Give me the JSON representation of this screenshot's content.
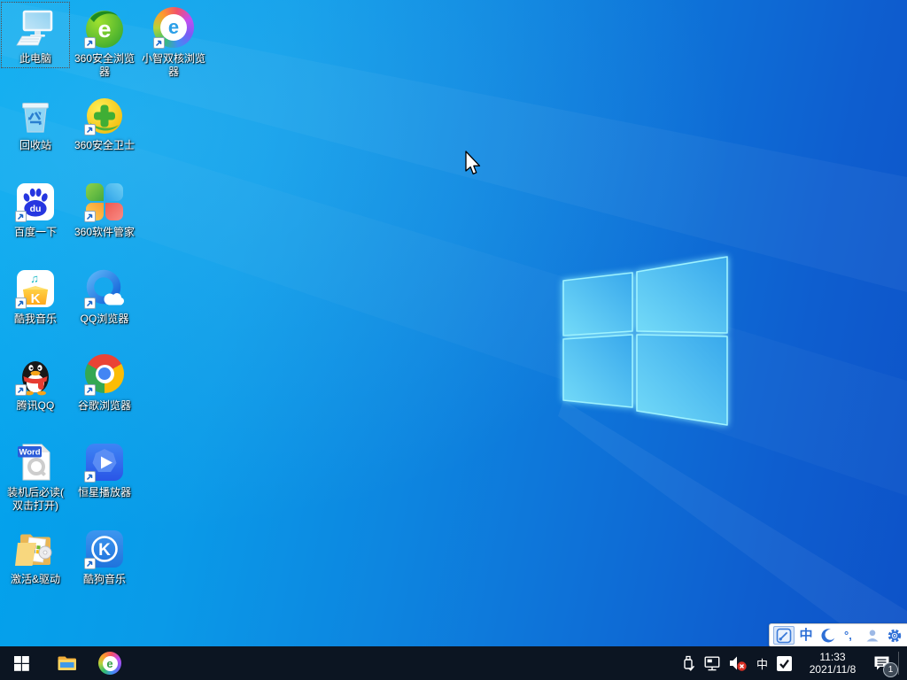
{
  "wallpaper": {
    "name": "windows-10-light-ray",
    "base_left_color": "#00a6ee",
    "base_right_color": "#0d52c8",
    "logo_edge_color": "#9ef2fe"
  },
  "desktop_icons": [
    {
      "id": "this-pc",
      "label": "此电脑",
      "selected": true,
      "shortcut": false
    },
    {
      "id": "360-secure-browser",
      "label": "360安全浏览\n器",
      "selected": false,
      "shortcut": true
    },
    {
      "id": "xiaozhi-dual-core-browser",
      "label": "小智双核浏览\n器",
      "selected": false,
      "shortcut": true
    },
    {
      "id": "recycle-bin",
      "label": "回收站",
      "selected": false,
      "shortcut": false
    },
    {
      "id": "360-safe-guard",
      "label": "360安全卫士",
      "selected": false,
      "shortcut": true
    },
    {
      "id": "baidu-search",
      "label": "百度一下",
      "selected": false,
      "shortcut": true
    },
    {
      "id": "360-software-manager",
      "label": "360软件管家",
      "selected": false,
      "shortcut": true
    },
    {
      "id": "kuwo-music",
      "label": "酷我音乐",
      "selected": false,
      "shortcut": true
    },
    {
      "id": "qq-browser",
      "label": "QQ浏览器",
      "selected": false,
      "shortcut": true
    },
    {
      "id": "tencent-qq",
      "label": "腾讯QQ",
      "selected": false,
      "shortcut": true
    },
    {
      "id": "google-chrome",
      "label": "谷歌浏览器",
      "selected": false,
      "shortcut": true
    },
    {
      "id": "readme-doc",
      "label": "装机后必读(\n双击打开)",
      "selected": false,
      "shortcut": false
    },
    {
      "id": "star-player",
      "label": "恒星播放器",
      "selected": false,
      "shortcut": true
    },
    {
      "id": "activation-drivers",
      "label": "激活&驱动",
      "selected": false,
      "shortcut": false
    },
    {
      "id": "kugou-music",
      "label": "酷狗音乐",
      "selected": false,
      "shortcut": true
    }
  ],
  "icon_glyphs": {
    "e_green": "e",
    "e_ring": "e",
    "e_taskbar": "e",
    "baidu_du": "du",
    "kuwo_k": "K",
    "kugou_k": "K",
    "word_badge": "Word",
    "kuwo_notes": "♫"
  },
  "ime_bar": {
    "mode_char": "中",
    "punct": "°,"
  },
  "taskbar": {
    "tray_input_char": "中",
    "clock": {
      "time": "11:33",
      "date": "2021/11/8"
    },
    "notification_badge": "1"
  }
}
